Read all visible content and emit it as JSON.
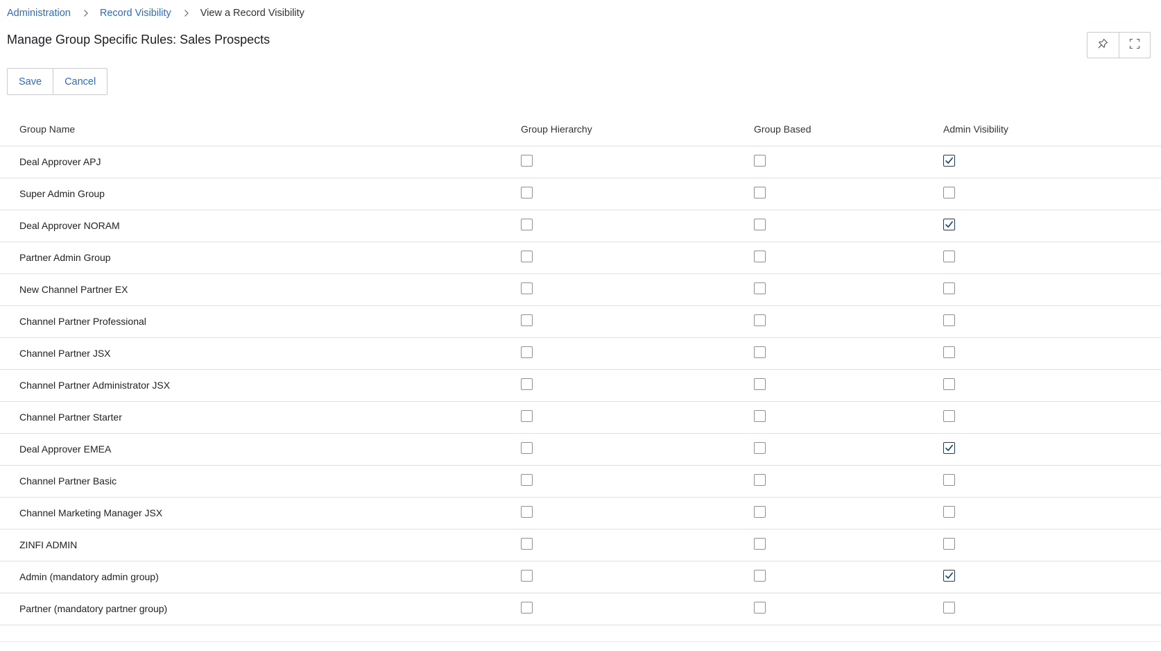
{
  "breadcrumb": {
    "items": [
      "Administration",
      "Record Visibility"
    ],
    "current": "View a Record Visibility"
  },
  "page": {
    "title": "Manage Group Specific Rules: Sales Prospects"
  },
  "tools": {
    "pin_icon": "pin-icon",
    "fullscreen_icon": "fullscreen-icon"
  },
  "actions": {
    "save_label": "Save",
    "cancel_label": "Cancel"
  },
  "colors": {
    "link": "#2b6cc4",
    "check": "#1c3a5c",
    "border": "#c8ccd1"
  },
  "table": {
    "headers": [
      "Group Name",
      "Group Hierarchy",
      "Group Based",
      "Admin Visibility"
    ],
    "rows": [
      {
        "name": "Deal Approver APJ",
        "hierarchy": false,
        "based": false,
        "admin": true
      },
      {
        "name": "Super Admin Group",
        "hierarchy": false,
        "based": false,
        "admin": false
      },
      {
        "name": "Deal Approver NORAM",
        "hierarchy": false,
        "based": false,
        "admin": true
      },
      {
        "name": "Partner Admin Group",
        "hierarchy": false,
        "based": false,
        "admin": false
      },
      {
        "name": "New Channel Partner EX",
        "hierarchy": false,
        "based": false,
        "admin": false
      },
      {
        "name": "Channel Partner Professional",
        "hierarchy": false,
        "based": false,
        "admin": false
      },
      {
        "name": "Channel Partner JSX",
        "hierarchy": false,
        "based": false,
        "admin": false
      },
      {
        "name": "Channel Partner Administrator JSX",
        "hierarchy": false,
        "based": false,
        "admin": false
      },
      {
        "name": "Channel Partner Starter",
        "hierarchy": false,
        "based": false,
        "admin": false
      },
      {
        "name": "Deal Approver EMEA",
        "hierarchy": false,
        "based": false,
        "admin": true
      },
      {
        "name": "Channel Partner Basic",
        "hierarchy": false,
        "based": false,
        "admin": false
      },
      {
        "name": "Channel Marketing Manager JSX",
        "hierarchy": false,
        "based": false,
        "admin": false
      },
      {
        "name": "ZINFI ADMIN",
        "hierarchy": false,
        "based": false,
        "admin": false
      },
      {
        "name": "Admin (mandatory admin group)",
        "hierarchy": false,
        "based": false,
        "admin": true
      },
      {
        "name": "Partner (mandatory partner group)",
        "hierarchy": false,
        "based": false,
        "admin": false
      }
    ]
  }
}
